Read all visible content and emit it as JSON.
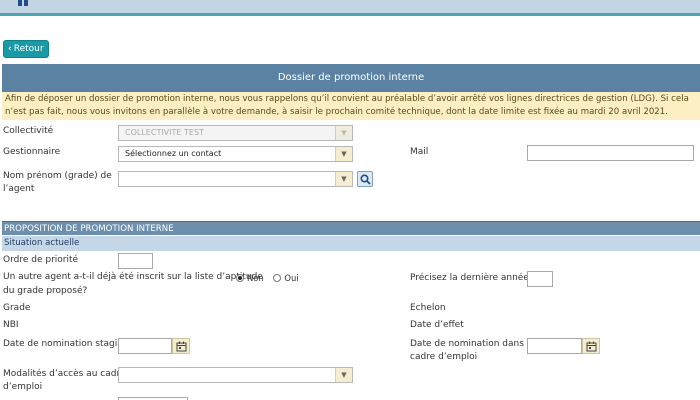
{
  "header": {
    "logo_icon": "logo-icon"
  },
  "nav": {
    "back_label": "Retour"
  },
  "panel": {
    "title": "Dossier de promotion interne"
  },
  "notice": {
    "text": "Afin de déposer un dossier de promotion interne, nous vous rappelons qu’il convient au préalable d’avoir arrêté vos lignes directrices de gestion (LDG). Si cela n’est pas fait, nous vous invitons en parallèle à votre demande, à saisir le prochain comité technique, dont la date limite est fixée au mardi 20 avril 2021."
  },
  "form": {
    "collectivite_label": "Collectivité",
    "collectivite_value": "COLLECTIVITE TEST",
    "gestionnaire_label": "Gestionnaire",
    "gestionnaire_value": "Sélectionnez un contact",
    "mail_label": "Mail",
    "mail_value": "",
    "nom_label_line1": "Nom prénom (grade) de",
    "nom_label_line2": "l’agent",
    "nom_value": ""
  },
  "proposition": {
    "section_title": "PROPOSITION DE PROMOTION INTERNE",
    "subsection_title": "Situation actuelle",
    "ordre_label": "Ordre de priorité",
    "ordre_value": "",
    "autre_agent_line1": "Un autre agent a-t-il déjà été inscrit sur la liste d’aptitude",
    "autre_agent_line2": "du grade proposé?",
    "radio_non": "Non",
    "radio_oui": "Oui",
    "radio_selected": "Non",
    "derniere_annee_label": "Précisez la dernière année",
    "derniere_annee_value": "",
    "grade_label": "Grade",
    "echelon_label": "Echelon",
    "nbi_label": "NBI",
    "date_effet_label": "Date d’effet",
    "date_stagiaire_label": "Date de nomination stagiaire",
    "date_stagiaire_value": "",
    "date_cadre_line1": "Date de nomination dans le",
    "date_cadre_line2": "cadre d’emploi",
    "date_cadre_value": "",
    "modalites_line1": "Modalités d’accès au cadre",
    "modalites_line2": "d’emploi",
    "modalites_value": ""
  }
}
